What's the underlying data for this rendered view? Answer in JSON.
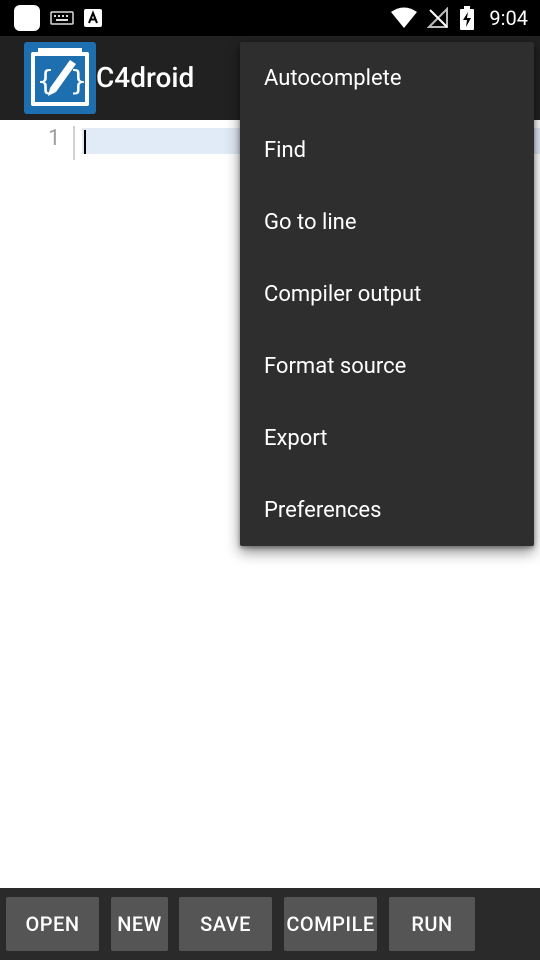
{
  "status_bar": {
    "time": "9:04",
    "icons": [
      "app-notification-icon",
      "keyboard-icon",
      "font-a-icon",
      "wifi-icon",
      "no-signal-icon",
      "battery-charging-icon"
    ]
  },
  "app_bar": {
    "title": "C4droid",
    "logo_icon": "c4droid-logo-icon",
    "background": "#212121"
  },
  "editor": {
    "line_numbers": [
      "1"
    ],
    "content": "",
    "current_line_highlight": "#e0ebf7"
  },
  "overflow_menu": {
    "items": [
      {
        "label": "Autocomplete"
      },
      {
        "label": "Find"
      },
      {
        "label": "Go to line"
      },
      {
        "label": "Compiler output"
      },
      {
        "label": "Format source"
      },
      {
        "label": "Export"
      },
      {
        "label": "Preferences"
      }
    ],
    "background": "#2e2e2e"
  },
  "toolbar": {
    "open_label": "OPEN",
    "new_label": "NEW",
    "save_label": "SAVE",
    "compile_label": "COMPILE",
    "run_label": "RUN",
    "button_color": "#555555",
    "background": "#2a2a2a"
  }
}
